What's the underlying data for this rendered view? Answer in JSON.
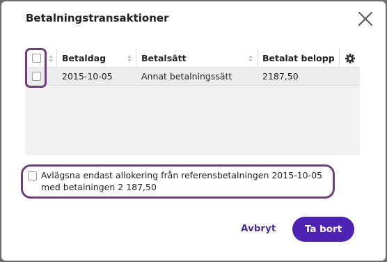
{
  "dialog": {
    "title": "Betalningstransaktioner",
    "close_icon": "close-icon"
  },
  "table": {
    "columns": [
      {
        "label": "Betaldag",
        "sortable": true
      },
      {
        "label": "Betalsätt",
        "sortable": true
      },
      {
        "label": "Betalat belopp",
        "sortable": false
      }
    ],
    "settings_icon": "gear-icon",
    "select_all_checked": false,
    "rows": [
      {
        "checked": false,
        "date": "2015-10-05",
        "method": "Annat betalningssätt",
        "amount": "2187,50"
      }
    ]
  },
  "option": {
    "checked": false,
    "label": "Avlägsna endast allokering från referensbetalningen 2015-10-05 med betalningen 2 187,50"
  },
  "actions": {
    "cancel_label": "Avbryt",
    "confirm_label": "Ta bort"
  },
  "colors": {
    "accent": "#4e23b3",
    "highlight": "#6b3f78"
  }
}
